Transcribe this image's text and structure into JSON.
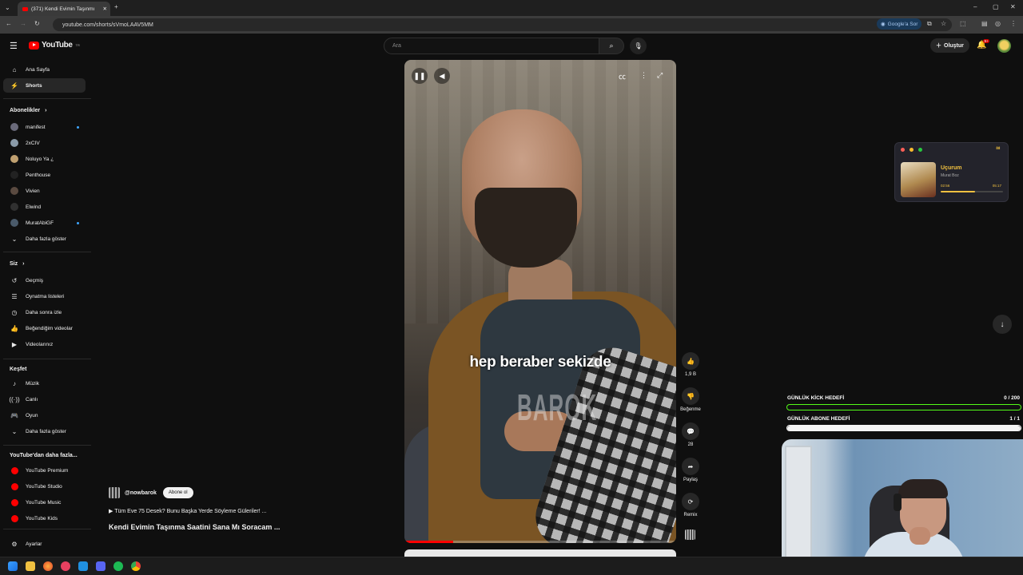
{
  "browser": {
    "tab_title": "(371) Kendi Evimin Taşınmı",
    "url": "youtube.com/shorts/sVmoLAAV5MM",
    "google_sor": "Google'a Sor"
  },
  "header": {
    "logo_text": "YouTube",
    "logo_region": "TR",
    "search_placeholder": "Ara",
    "create_label": "Oluştur",
    "notif_badge": "9+"
  },
  "sidebar": {
    "main": [
      {
        "label": "Ana Sayfa",
        "icon": "home-icon"
      },
      {
        "label": "Shorts",
        "icon": "shorts-icon",
        "active": true
      }
    ],
    "subs_heading": "Abonelikler",
    "subs": [
      {
        "label": "manifest",
        "color": "#6a6a7a",
        "dot": true
      },
      {
        "label": "2xCIV",
        "color": "#8a9aa8",
        "dot": false
      },
      {
        "label": "Noluyo Ya ¿",
        "color": "#c0a070",
        "dot": false
      },
      {
        "label": "Penthouse",
        "color": "#222222",
        "dot": false
      },
      {
        "label": "Vivien",
        "color": "#5a4a40",
        "dot": false
      },
      {
        "label": "Elwind",
        "color": "#303030",
        "dot": false
      },
      {
        "label": "MuratAbiGF",
        "color": "#4a5a6a",
        "dot": true
      }
    ],
    "subs_more": "Daha fazla göster",
    "you_heading": "Siz",
    "you": [
      {
        "label": "Geçmiş",
        "icon": "history-icon"
      },
      {
        "label": "Oynatma listeleri",
        "icon": "playlist-icon"
      },
      {
        "label": "Daha sonra izle",
        "icon": "clock-icon"
      },
      {
        "label": "Beğendiğim videolar",
        "icon": "thumb-up-icon"
      },
      {
        "label": "Videolarınız",
        "icon": "video-icon"
      }
    ],
    "explore_heading": "Keşfet",
    "explore": [
      {
        "label": "Müzik",
        "icon": "music-icon"
      },
      {
        "label": "Canlı",
        "icon": "live-icon"
      },
      {
        "label": "Oyun",
        "icon": "gamepad-icon"
      }
    ],
    "explore_more": "Daha fazla göster",
    "more_heading": "YouTube'dan daha fazla...",
    "more": [
      {
        "label": "YouTube Premium"
      },
      {
        "label": "YouTube Studio"
      },
      {
        "label": "YouTube Music"
      },
      {
        "label": "YouTube Kids"
      }
    ],
    "settings": "Ayarlar"
  },
  "video": {
    "subtitle": "hep beraber sekizde",
    "watermark": "BAROK",
    "progress": 0.18
  },
  "channel": {
    "handle": "@nowbarok",
    "subscribe": "Abone ol",
    "description": "▶ Tüm Eve 75 Desek? Bunu Başka Yerde Söyleme Güleriler! ...",
    "title": "Kendi Evimin Taşınma Saatini Sana Mı Soracam ..."
  },
  "actions": {
    "like_count": "1,9 B",
    "dislike": "Beğenme",
    "comments": "28",
    "share": "Paylaş",
    "remix": "Remix"
  },
  "music_widget": {
    "title": "Uçurum",
    "artist": "Murat Boz",
    "elapsed": "02:56",
    "total": "05:17",
    "progress": 0.55
  },
  "goals": [
    {
      "label": "GÜNLÜK KİCK HEDEFİ",
      "value": "0  /  200",
      "fraction": 0
    },
    {
      "label": "GÜNLÜK ABONE HEDEFİ",
      "value": "1  /  1",
      "fraction": 1
    }
  ]
}
